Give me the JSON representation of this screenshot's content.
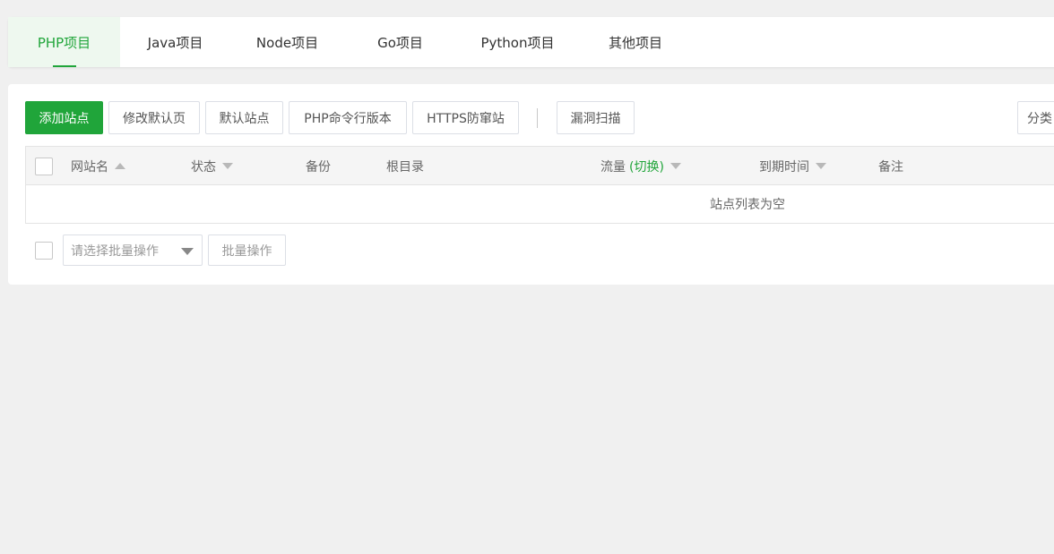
{
  "tabs": [
    {
      "label": "PHP项目",
      "active": true
    },
    {
      "label": "Java项目",
      "active": false
    },
    {
      "label": "Node项目",
      "active": false
    },
    {
      "label": "Go项目",
      "active": false
    },
    {
      "label": "Python项目",
      "active": false
    },
    {
      "label": "其他项目",
      "active": false
    }
  ],
  "toolbar": {
    "add_site": "添加站点",
    "modify_default_page": "修改默认页",
    "default_site": "默认站点",
    "php_cli_version": "PHP命令行版本",
    "https_anti_takeover": "HTTPS防窜站",
    "vuln_scan": "漏洞扫描",
    "category": "分类"
  },
  "table": {
    "columns": {
      "site_name": "网站名",
      "status": "状态",
      "backup": "备份",
      "root_dir": "根目录",
      "traffic": "流量",
      "traffic_toggle": "(切换)",
      "expire_time": "到期时间",
      "remark": "备注"
    },
    "empty_text": "站点列表为空"
  },
  "batch": {
    "select_placeholder": "请选择批量操作",
    "action_label": "批量操作"
  },
  "colors": {
    "accent": "#20a53a",
    "background": "#f0f0f0"
  }
}
